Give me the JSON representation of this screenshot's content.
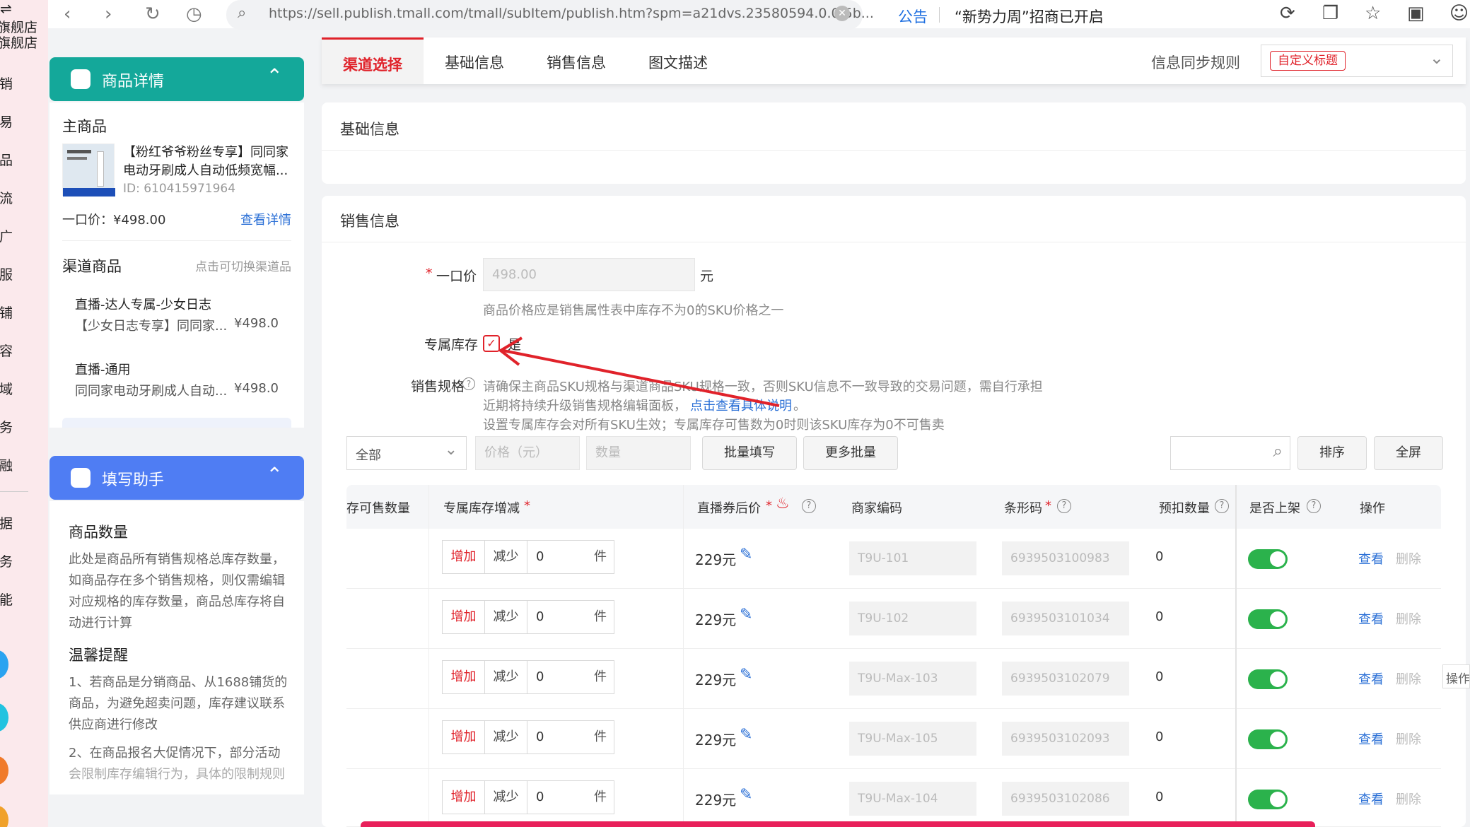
{
  "browser": {
    "url": "https://sell.publish.tmall.com/tmall/subItem/publish.htm?spm=a21dvs.23580594.0.0.5b...",
    "notice_label": "公告",
    "notice_text": "“新势力周”招商已开启"
  },
  "left_nav": {
    "items": [
      "旗舰店",
      "旗舰店",
      "营销",
      "交易",
      "商品",
      "物流",
      "推广",
      "客服",
      "店铺",
      "内容",
      "人域",
      "财务",
      "金融",
      "数据",
      "服务",
      "智能"
    ]
  },
  "product_detail": {
    "header": "商品详情",
    "main_product_title": "主商品",
    "product_name": "【粉红爷爷粉丝专享】同同家电动牙刷成人自动低频宽幅...",
    "product_id": "ID: 610415971964",
    "price": "一口价：¥498.00",
    "view_detail": "查看详情",
    "channel_title": "渠道商品",
    "channel_hint": "点击可切换渠道品",
    "channels": [
      {
        "name": "直播-达人专属-少女日志",
        "desc": "【少女日志专享】同同家...",
        "price": "¥498.0"
      },
      {
        "name": "直播-通用",
        "desc": "同同家电动牙刷成人自动...",
        "price": "¥498.0"
      }
    ]
  },
  "helper": {
    "header": "填写助手",
    "section1_title": "商品数量",
    "section1_lines": [
      "此处是商品所有销售规格总库存数量，",
      "如商品存在多个销售规格，则仅需编辑",
      "对应规格的库存数量，商品总库存将自",
      "动进行计算"
    ],
    "section2_title": "温馨提醒",
    "section2_lines": [
      "1、若商品是分销商品、从1688铺货的",
      "商品，为避免超卖问题，库存建议联系",
      "供应商进行修改",
      "2、在商品报名大促情况下，部分活动",
      "会限制库存编辑行为，具体的限制规则"
    ]
  },
  "tabs": [
    "渠道选择",
    "基础信息",
    "销售信息",
    "图文描述"
  ],
  "sync": {
    "label": "信息同步规则",
    "value": "自定义标题"
  },
  "basic_section_title": "基础信息",
  "sales": {
    "section_title": "销售信息",
    "price_label": "一口价",
    "price_value": "498.00",
    "price_unit": "元",
    "price_hint": "商品价格应是销售属性表中库存不为0的SKU价格之一",
    "exclusive_label": "专属库存",
    "exclusive_checked_label": "是",
    "spec_label": "销售规格",
    "spec_line1": "请确保主商品SKU规格与渠道商品SKU规格一致，否则SKU信息不一致导致的交易问题，需自行承担",
    "spec_line2_pre": "近期将持续升级销售规格编辑面板，",
    "spec_line2_link": "点击查看具体说明",
    "spec_line2_post": "。",
    "spec_line3": "设置专属库存会对所有SKU生效；专属库存可售数为0时则该SKU库存为0不可售卖"
  },
  "toolbar": {
    "filter_value": "全部",
    "price_placeholder": "价格（元）",
    "qty_placeholder": "数量",
    "batch_fill": "批量填写",
    "more_batch": "更多批量",
    "sort": "排序",
    "fullscreen": "全屏"
  },
  "table": {
    "headers": [
      "存可售数量",
      "专属库存增减",
      "直播券后价",
      "商家编码",
      "条形码",
      "预扣数量",
      "是否上架",
      "操作"
    ],
    "add_label": "增加",
    "sub_label": "减少",
    "unit": "件",
    "view_label": "查看",
    "delete_label": "删除",
    "side_label": "操作",
    "rows": [
      {
        "qty": "0",
        "price": "229元",
        "code": "T9U-101",
        "barcode": "6939503100983",
        "withhold": "0",
        "on_shelf": true
      },
      {
        "qty": "0",
        "price": "229元",
        "code": "T9U-102",
        "barcode": "6939503101034",
        "withhold": "0",
        "on_shelf": true
      },
      {
        "qty": "0",
        "price": "229元",
        "code": "T9U-Max-103",
        "barcode": "6939503102079",
        "withhold": "0",
        "on_shelf": true
      },
      {
        "qty": "0",
        "price": "229元",
        "code": "T9U-Max-105",
        "barcode": "6939503102093",
        "withhold": "0",
        "on_shelf": true
      },
      {
        "qty": "0",
        "price": "229元",
        "code": "T9U-Max-104",
        "barcode": "6939503102086",
        "withhold": "0",
        "on_shelf": true
      }
    ]
  },
  "colors": {
    "accent_red": "#e0222a",
    "teal": "#14a89a",
    "blue_header": "#4f7df3",
    "toggle_green": "#2bb24c",
    "link_blue": "#2a6fd6"
  }
}
